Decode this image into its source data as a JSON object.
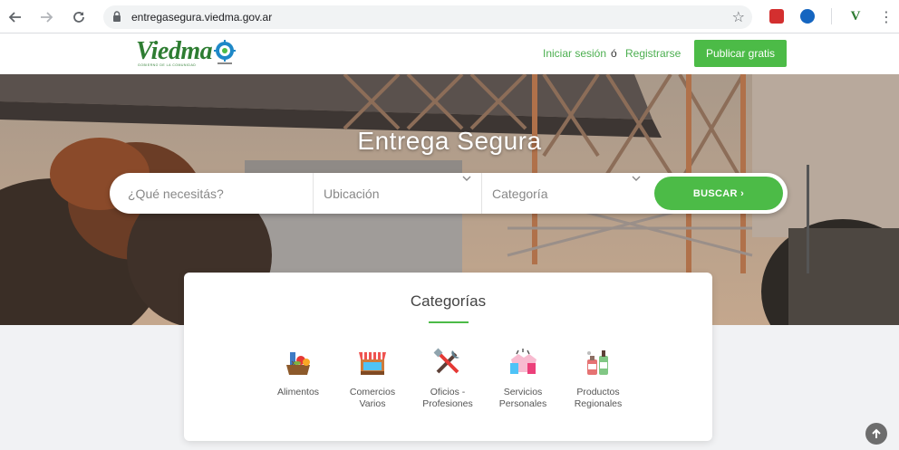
{
  "browser": {
    "url": "entregasegura.viedma.gov.ar",
    "icons": [
      "back-icon",
      "forward-icon",
      "reload-icon",
      "lock-icon",
      "star-icon",
      "menu-icon"
    ],
    "extension_colors": [
      "#d32f2f",
      "#1565c0",
      "#2e7d32"
    ]
  },
  "header": {
    "logo_text": "Viedma",
    "logo_sub": "GOBIERNO DE LA COMUNIDAD",
    "login_label": "Iniciar sesión",
    "or_label": "ó",
    "register_label": "Registrarse",
    "publish_label": "Publicar gratis"
  },
  "hero": {
    "title": "Entrega Segura"
  },
  "search": {
    "query_placeholder": "¿Qué necesitás?",
    "location_value": "Ubicación",
    "category_value": "Categoría",
    "button_label": "BUSCAR ›"
  },
  "categories": {
    "title": "Categorías",
    "items": [
      {
        "label_1": "Alimentos",
        "label_2": "",
        "icon": "groceries-icon"
      },
      {
        "label_1": "Comercios",
        "label_2": "Varios",
        "icon": "storefront-icon"
      },
      {
        "label_1": "Oficios -",
        "label_2": "Profesiones",
        "icon": "tools-icon"
      },
      {
        "label_1": "Servicios",
        "label_2": "Personales",
        "icon": "handshake-icon"
      },
      {
        "label_1": "Productos",
        "label_2": "Regionales",
        "icon": "bottles-icon"
      }
    ]
  },
  "colors": {
    "accent": "#4cbb47",
    "link": "#4caf50"
  }
}
